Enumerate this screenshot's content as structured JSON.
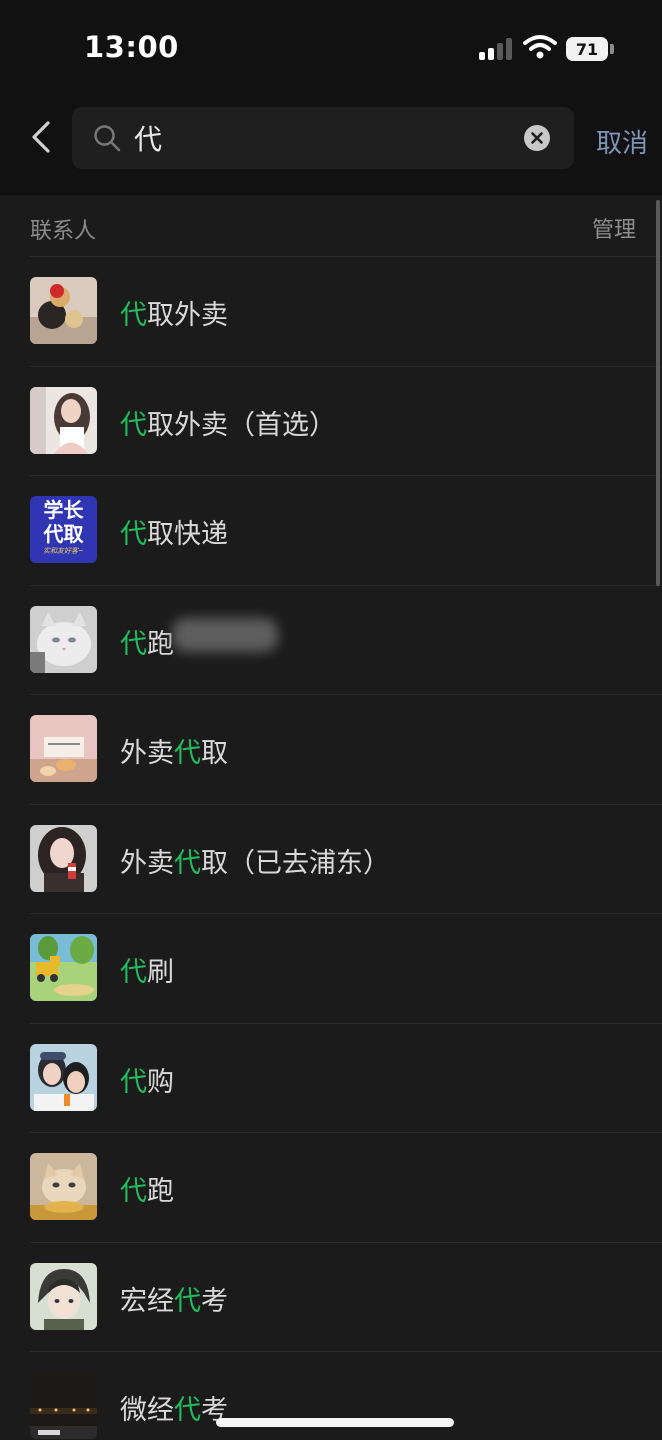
{
  "status_bar": {
    "time": "13:00",
    "battery": "71"
  },
  "search": {
    "query": "代",
    "cancel_label": "取消"
  },
  "section": {
    "title": "联系人",
    "manage_label": "管理"
  },
  "contacts": [
    {
      "prefix": "",
      "highlight": "代",
      "suffix": "取外卖",
      "avatar": "avatar-photo-toys"
    },
    {
      "prefix": "",
      "highlight": "代",
      "suffix": "取外卖（首选）",
      "avatar": "avatar-photo-girl"
    },
    {
      "prefix": "",
      "highlight": "代",
      "suffix": "取快递",
      "avatar": "avatar-text",
      "avatar_line1": "学长",
      "avatar_line2": "代取",
      "avatar_caption": "实和友好客~"
    },
    {
      "prefix": "",
      "highlight": "代",
      "suffix": "跑",
      "avatar": "avatar-photo-cat",
      "redacted": true
    },
    {
      "prefix": "外卖",
      "highlight": "代",
      "suffix": "取",
      "avatar": "avatar-photo-cake"
    },
    {
      "prefix": "外卖",
      "highlight": "代",
      "suffix": "取（已去浦东）",
      "avatar": "avatar-photo-girl-drink"
    },
    {
      "prefix": "",
      "highlight": "代",
      "suffix": "刷",
      "avatar": "avatar-illustration-truck"
    },
    {
      "prefix": "",
      "highlight": "代",
      "suffix": "购",
      "avatar": "avatar-photo-couple"
    },
    {
      "prefix": "",
      "highlight": "代",
      "suffix": "跑",
      "avatar": "avatar-photo-kitten"
    },
    {
      "prefix": "宏经",
      "highlight": "代",
      "suffix": "考",
      "avatar": "avatar-anime-boy"
    },
    {
      "prefix": "微经",
      "highlight": "代",
      "suffix": "考",
      "avatar": "avatar-photo-night"
    }
  ],
  "colors": {
    "background": "#1b1b1b",
    "header_background": "#111111",
    "highlight": "#22bb5e",
    "cancel": "#7f95b8",
    "text": "#d9d9d9",
    "muted": "#8a8a8a"
  }
}
